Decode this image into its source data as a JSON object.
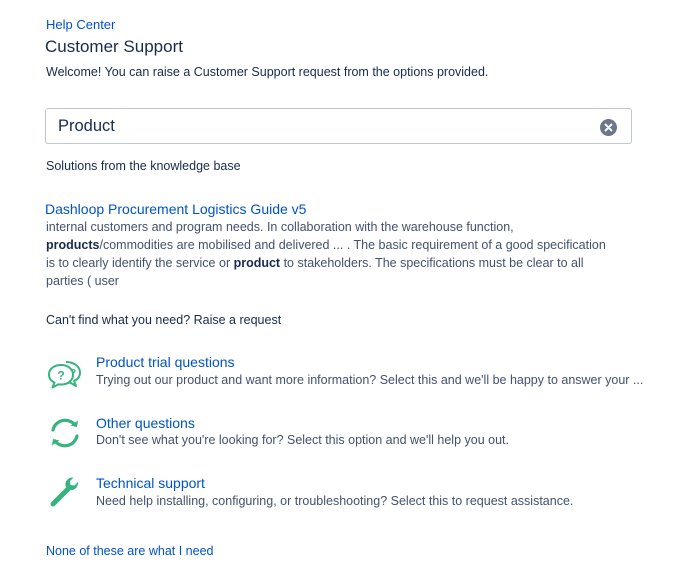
{
  "breadcrumb": {
    "help_center": "Help Center"
  },
  "page": {
    "title": "Customer Support",
    "welcome": "Welcome! You can raise a Customer Support request from the options provided."
  },
  "search": {
    "value": "Product",
    "clear_icon": "close-circle-icon"
  },
  "knowledge_base": {
    "heading": "Solutions from the knowledge base",
    "result": {
      "title": "Dashloop Procurement Logistics Guide v5",
      "excerpt_parts": [
        {
          "text": "internal customers and program needs. In collaboration with the warehouse function, ",
          "bold": false
        },
        {
          "text": "products",
          "bold": true
        },
        {
          "text": "/commodities are mobilised and delivered ... . The basic requirement of a good specification is to clearly identify the service or ",
          "bold": false
        },
        {
          "text": "product",
          "bold": true
        },
        {
          "text": " to stakeholders. The specifications must be clear to all parties ( user",
          "bold": false
        }
      ]
    }
  },
  "raise": {
    "heading": "Can't find what you need? Raise a request",
    "request_types": [
      {
        "name": "Product trial questions",
        "description": "Trying out our product and want more information? Select this and we'll be happy to answer your ...",
        "icon": "question-bubbles-icon"
      },
      {
        "name": "Other questions",
        "description": "Don't see what you're looking for? Select this option and we'll help you out.",
        "icon": "refresh-arrows-icon"
      },
      {
        "name": "Technical support",
        "description": "Need help installing, configuring, or troubleshooting? Select this to request assistance.",
        "icon": "wrench-icon"
      }
    ]
  },
  "footer": {
    "none_link": "None of these are what I need"
  },
  "colors": {
    "link": "#0052cc",
    "text": "#172b4d",
    "icon_green": "#36b37e",
    "subtle": "#42526e"
  }
}
